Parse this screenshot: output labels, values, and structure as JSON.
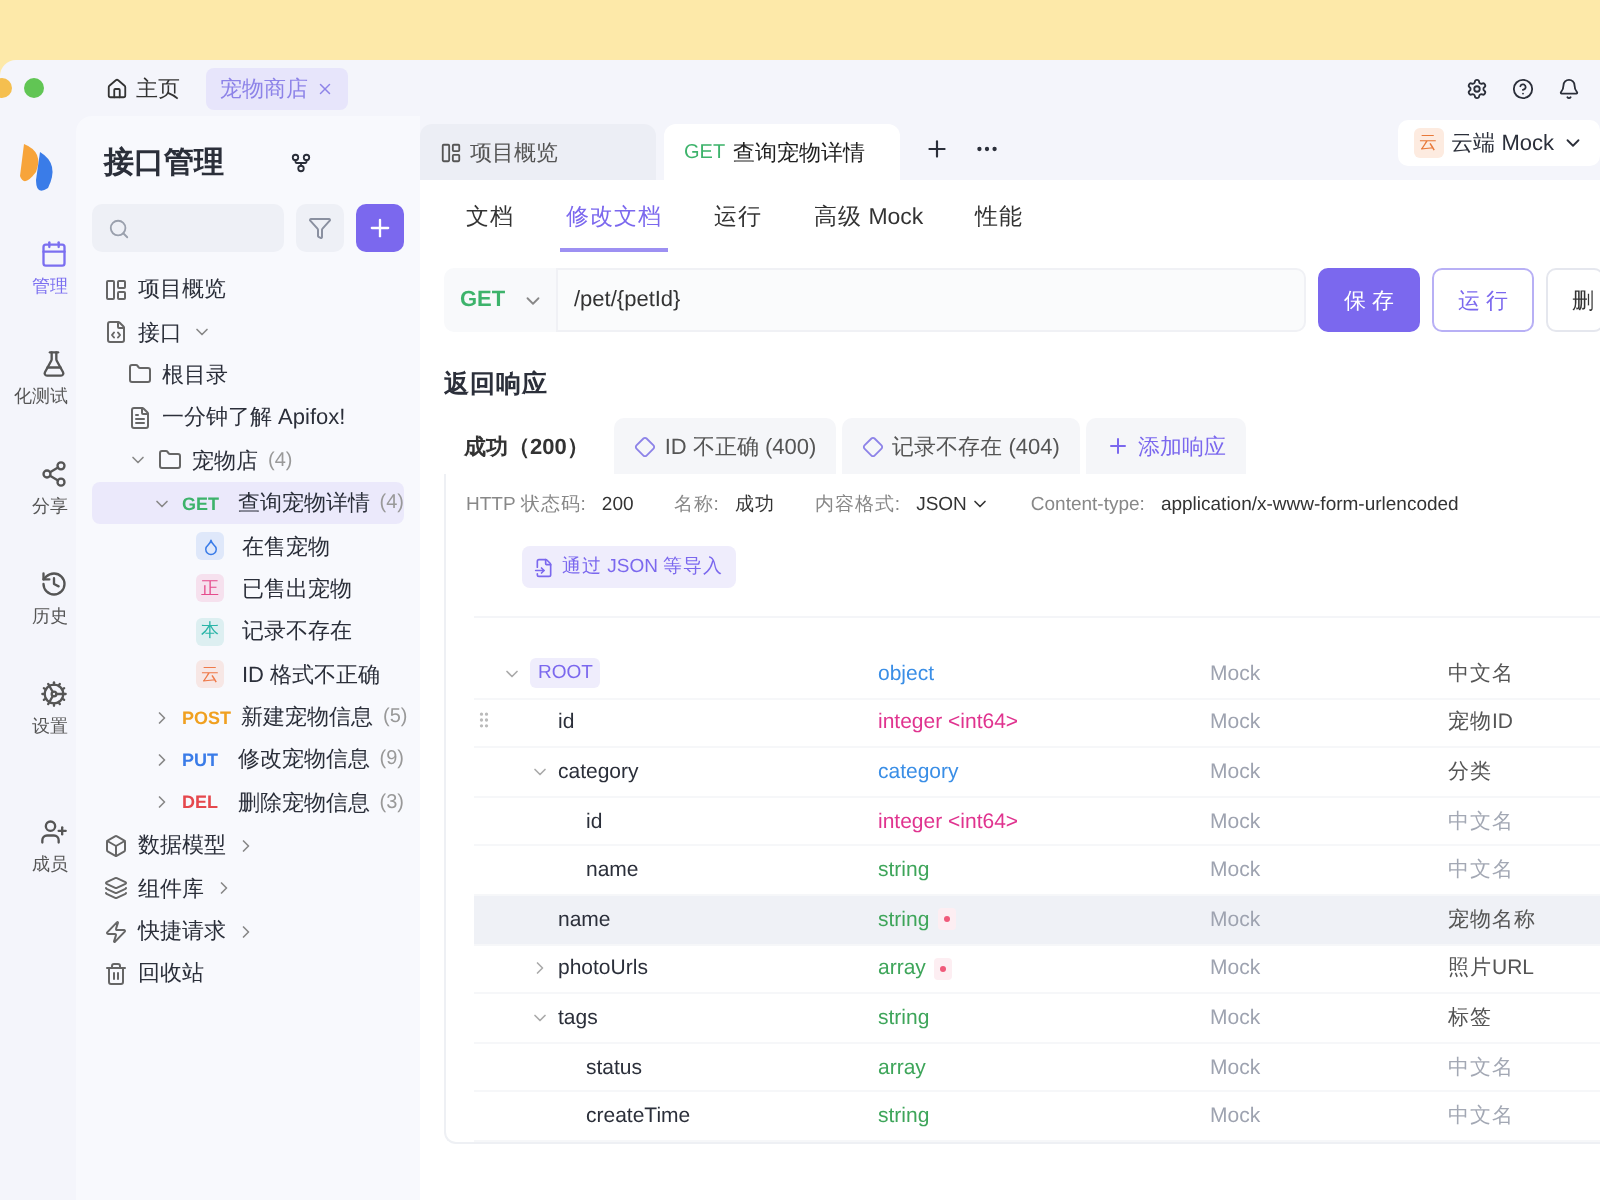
{
  "title_tabs": [
    {
      "kind": "home",
      "label": "主页",
      "selected": false,
      "closable": false
    },
    {
      "kind": "project",
      "label": "宠物商店",
      "selected": true,
      "closable": true
    }
  ],
  "rail": [
    {
      "kind": "api",
      "label": "管理",
      "selected": true
    },
    {
      "kind": "test",
      "label": "化测试",
      "selected": false
    },
    {
      "kind": "share",
      "label": "分享",
      "selected": false
    },
    {
      "kind": "history",
      "label": "历史",
      "selected": false
    },
    {
      "kind": "settings",
      "label": "设置",
      "selected": false
    },
    {
      "kind": "members",
      "label": "成员",
      "selected": false
    }
  ],
  "sidebar": {
    "title": "接口管理",
    "items": [
      {
        "kind": "overview",
        "label": "项目概览",
        "selected": false
      },
      {
        "kind": "api",
        "label": "接口",
        "selected": false,
        "expanded": true,
        "children": [
          {
            "kind": "folder",
            "label": "根目录",
            "selected": false
          },
          {
            "kind": "doc",
            "label": "一分钟了解 Apifox!",
            "selected": false
          },
          {
            "kind": "folder",
            "label": "宠物店",
            "count": "(4)",
            "selected": false,
            "expanded": true,
            "children": [
              {
                "kind": "endpoint",
                "method": "GET",
                "label": "查询宠物详情",
                "count": "(4)",
                "selected": true,
                "expanded": true,
                "children": [
                  {
                    "kind": "example",
                    "label": "在售宠物",
                    "color": "#3a7ce8",
                    "selected": false
                  },
                  {
                    "kind": "example",
                    "badge": "正",
                    "label": "已售出宠物",
                    "color": "#e54b8c",
                    "selected": false
                  },
                  {
                    "kind": "example",
                    "badge": "本",
                    "label": "记录不存在",
                    "color": "#2bb5a8",
                    "selected": false
                  },
                  {
                    "kind": "example",
                    "badge": "云",
                    "label": "ID 格式不正确",
                    "color": "#ef7a4a",
                    "selected": false
                  }
                ]
              },
              {
                "kind": "endpoint",
                "method": "POST",
                "label": "新建宠物信息",
                "count": "(5)",
                "selected": false,
                "expanded": false
              },
              {
                "kind": "endpoint",
                "method": "PUT",
                "label": "修改宠物信息",
                "count": "(9)",
                "selected": false,
                "expanded": false
              },
              {
                "kind": "endpoint",
                "method": "DEL",
                "label": "删除宠物信息",
                "count": "(3)",
                "selected": false,
                "expanded": false
              }
            ]
          }
        ]
      },
      {
        "kind": "models",
        "label": "数据模型",
        "selected": false,
        "expanded": false
      },
      {
        "kind": "components",
        "label": "组件库",
        "selected": false,
        "expanded": false
      },
      {
        "kind": "quick",
        "label": "快捷请求",
        "selected": false,
        "expanded": false
      },
      {
        "kind": "trash",
        "label": "回收站",
        "selected": false
      }
    ]
  },
  "editor_tabs": [
    {
      "kind": "overview",
      "label": "项目概览",
      "selected": false
    },
    {
      "kind": "endpoint",
      "method": "GET",
      "label": "查询宠物详情",
      "selected": true
    }
  ],
  "environment": {
    "badge": "云",
    "label": "云端 Mock"
  },
  "doc_tabs": [
    {
      "label": "文档",
      "selected": false
    },
    {
      "label": "修改文档",
      "selected": true
    },
    {
      "label": "运行",
      "selected": false
    },
    {
      "label": "高级 Mock",
      "selected": false
    },
    {
      "label": "性能",
      "selected": false
    }
  ],
  "request": {
    "method": "GET",
    "path": "/pet/{petId}",
    "buttons": [
      {
        "kind": "primary",
        "label": "保 存"
      },
      {
        "kind": "outline",
        "label": "运 行"
      },
      {
        "kind": "plain",
        "label": "删"
      }
    ]
  },
  "responses": {
    "title": "返回响应",
    "tabs": [
      {
        "kind": "plain",
        "label": "成功（200）",
        "selected": true
      },
      {
        "kind": "response",
        "label": "ID 不正确 (400)",
        "selected": false
      },
      {
        "kind": "response",
        "label": "记录不存在 (404)",
        "selected": false
      },
      {
        "kind": "add",
        "label": "添加响应",
        "selected": false
      }
    ],
    "info": [
      {
        "label": "HTTP 状态码:",
        "value": "200",
        "dropdown": false
      },
      {
        "label": "名称:",
        "value": "成功",
        "dropdown": false
      },
      {
        "label": "内容格式:",
        "value": "JSON",
        "dropdown": true
      },
      {
        "label": "Content-type:",
        "value": "application/x-www-form-urlencoded",
        "dropdown": false
      }
    ],
    "import_button": "通过 JSON 等导入",
    "schema": [
      {
        "name": "ROOT",
        "root": true,
        "type": "object",
        "color": "#3a8ee6",
        "required": false,
        "mock": "Mock",
        "description": "中文名",
        "placeholder": false,
        "highlighted": false,
        "drag_handle": false,
        "expanded": true,
        "children": [
          {
            "name": "id",
            "root": false,
            "type": "integer <int64>",
            "color": "#e0338f",
            "required": false,
            "mock": "Mock",
            "description": "宠物ID",
            "placeholder": false,
            "highlighted": false,
            "drag_handle": true
          },
          {
            "name": "category",
            "root": false,
            "type": "category",
            "color": "#3a8ee6",
            "required": false,
            "mock": "Mock",
            "description": "分类",
            "placeholder": false,
            "highlighted": false,
            "drag_handle": false,
            "expanded": true,
            "children": [
              {
                "name": "id",
                "root": false,
                "type": "integer <int64>",
                "color": "#e0338f",
                "required": false,
                "mock": "Mock",
                "description": "中文名",
                "placeholder": true,
                "highlighted": false,
                "drag_handle": false
              },
              {
                "name": "name",
                "root": false,
                "type": "string",
                "color": "#3ea55a",
                "required": false,
                "mock": "Mock",
                "description": "中文名",
                "placeholder": true,
                "highlighted": false,
                "drag_handle": false
              }
            ]
          },
          {
            "name": "name",
            "root": false,
            "type": "string",
            "color": "#3ea55a",
            "required": true,
            "mock": "Mock",
            "description": "宠物名称",
            "placeholder": false,
            "highlighted": true,
            "drag_handle": false
          },
          {
            "name": "photoUrls",
            "root": false,
            "type": "array",
            "color": "#3ea55a",
            "required": true,
            "mock": "Mock",
            "description": "照片URL",
            "placeholder": false,
            "highlighted": false,
            "drag_handle": false,
            "expanded": false
          },
          {
            "name": "tags",
            "root": false,
            "type": "string",
            "color": "#3ea55a",
            "required": false,
            "mock": "Mock",
            "description": "标签",
            "placeholder": false,
            "highlighted": false,
            "drag_handle": false,
            "expanded": true,
            "children": [
              {
                "name": "status",
                "root": false,
                "type": "array",
                "color": "#3ea55a",
                "required": false,
                "mock": "Mock",
                "description": "中文名",
                "placeholder": true,
                "highlighted": false,
                "drag_handle": false
              },
              {
                "name": "createTime",
                "root": false,
                "type": "string",
                "color": "#3ea55a",
                "required": false,
                "mock": "Mock",
                "description": "中文名",
                "placeholder": true,
                "highlighted": false,
                "drag_handle": false
              }
            ]
          }
        ]
      }
    ]
  }
}
